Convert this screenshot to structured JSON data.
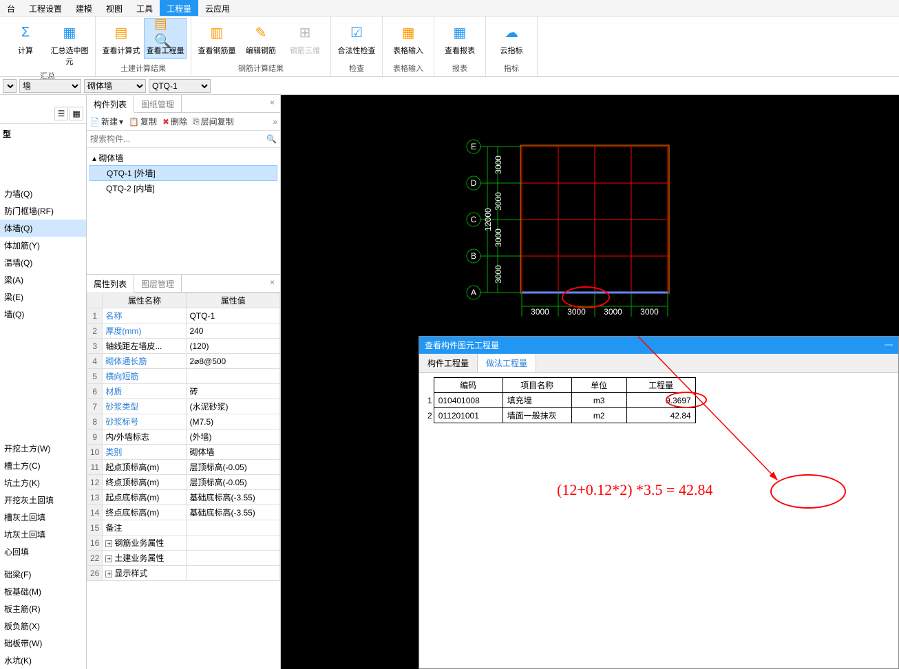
{
  "menu": [
    "台",
    "工程设置",
    "建模",
    "视图",
    "工具",
    "工程量",
    "云应用"
  ],
  "menu_active": 5,
  "ribbon": {
    "groups": [
      {
        "label": "汇总",
        "buttons": [
          {
            "icon": "Σ",
            "color": "#2196F3",
            "label": "计算"
          },
          {
            "icon": "▦",
            "color": "#2196F3",
            "label": "汇总选中图元"
          }
        ]
      },
      {
        "label": "土建计算结果",
        "buttons": [
          {
            "icon": "▤",
            "color": "#ff9800",
            "label": "查看计算式"
          },
          {
            "icon": "▤🔍",
            "color": "#ff9800",
            "label": "查看工程量",
            "active": true
          }
        ]
      },
      {
        "label": "钢筋计算结果",
        "buttons": [
          {
            "icon": "▥",
            "color": "#ff9800",
            "label": "查看钢筋量"
          },
          {
            "icon": "✎",
            "color": "#ff9800",
            "label": "编辑钢筋"
          },
          {
            "icon": "⊞",
            "color": "#bbb",
            "label": "钢筋三维",
            "disabled": true
          }
        ]
      },
      {
        "label": "检查",
        "buttons": [
          {
            "icon": "☑",
            "color": "#2196F3",
            "label": "合法性检查"
          }
        ]
      },
      {
        "label": "表格输入",
        "buttons": [
          {
            "icon": "▦",
            "color": "#ff9800",
            "label": "表格输入"
          }
        ]
      },
      {
        "label": "报表",
        "buttons": [
          {
            "icon": "▦",
            "color": "#2196F3",
            "label": "查看报表"
          }
        ]
      },
      {
        "label": "指标",
        "buttons": [
          {
            "icon": "☁",
            "color": "#2196F3",
            "label": "云指标"
          }
        ]
      }
    ]
  },
  "selectors": {
    "s1": "",
    "s2": "墙",
    "s3": "砌体墙",
    "s4": "QTQ-1"
  },
  "left_sidebar": {
    "title": "型",
    "items_top": [
      {
        "label": "力墙(Q)"
      },
      {
        "label": "防门框墙(RF)"
      },
      {
        "label": "体墙(Q)",
        "selected": true
      },
      {
        "label": "体加筋(Y)"
      },
      {
        "label": "温墙(Q)"
      },
      {
        "label": "梁(A)"
      },
      {
        "label": "梁(E)"
      },
      {
        "label": "墙(Q)"
      }
    ],
    "items_bottom": [
      "开挖土方(W)",
      "槽土方(C)",
      "坑土方(K)",
      "开挖灰土回填",
      "槽灰土回填",
      "坑灰土回填",
      "心回填",
      "",
      "础梁(F)",
      "板基础(M)",
      "板主筋(R)",
      "板负筋(X)",
      "础板带(W)",
      "水坑(K)"
    ]
  },
  "component_list": {
    "tabs": [
      "构件列表",
      "图纸管理"
    ],
    "toolbar": {
      "new": "新建",
      "copy": "复制",
      "delete": "删除",
      "floor_copy": "层间复制"
    },
    "search_placeholder": "搜索构件...",
    "tree": {
      "parent": "砌体墙",
      "children": [
        {
          "label": "QTQ-1 [外墙]",
          "selected": true
        },
        {
          "label": "QTQ-2 [内墙]"
        }
      ]
    }
  },
  "properties": {
    "tabs": [
      "属性列表",
      "图层管理"
    ],
    "headers": [
      "属性名称",
      "属性值"
    ],
    "rows": [
      {
        "n": "1",
        "name": "名称",
        "value": "QTQ-1",
        "link": true
      },
      {
        "n": "2",
        "name": "厚度(mm)",
        "value": "240",
        "link": true
      },
      {
        "n": "3",
        "name": "轴线距左墙皮...",
        "value": "(120)"
      },
      {
        "n": "4",
        "name": "砌体通长筋",
        "value": "2⌀8@500",
        "link": true
      },
      {
        "n": "5",
        "name": "横向短筋",
        "value": "",
        "link": true
      },
      {
        "n": "6",
        "name": "材质",
        "value": "砖",
        "link": true
      },
      {
        "n": "7",
        "name": "砂浆类型",
        "value": "(水泥砂浆)",
        "link": true
      },
      {
        "n": "8",
        "name": "砂浆标号",
        "value": "(M7.5)",
        "link": true
      },
      {
        "n": "9",
        "name": "内/外墙标志",
        "value": "(外墙)"
      },
      {
        "n": "10",
        "name": "类别",
        "value": "砌体墙",
        "link": true
      },
      {
        "n": "11",
        "name": "起点顶标高(m)",
        "value": "层顶标高(-0.05)"
      },
      {
        "n": "12",
        "name": "终点顶标高(m)",
        "value": "层顶标高(-0.05)"
      },
      {
        "n": "13",
        "name": "起点底标高(m)",
        "value": "基础底标高(-3.55)"
      },
      {
        "n": "14",
        "name": "终点底标高(m)",
        "value": "基础底标高(-3.55)"
      },
      {
        "n": "15",
        "name": "备注",
        "value": ""
      },
      {
        "n": "16",
        "name": "钢筋业务属性",
        "value": "",
        "exp": true
      },
      {
        "n": "22",
        "name": "土建业务属性",
        "value": "",
        "exp": true
      },
      {
        "n": "26",
        "name": "显示样式",
        "value": "",
        "exp": true
      }
    ]
  },
  "drawing": {
    "axis_labels_v": [
      "E",
      "D",
      "C",
      "B",
      "A"
    ],
    "axis_labels_h": [
      "3000",
      "3000",
      "3000",
      "3000"
    ],
    "total_v": "12000",
    "dim_v": [
      "3000",
      "3000",
      "3000",
      "3000"
    ]
  },
  "qty_dialog": {
    "title": "查看构件图元工程量",
    "tabs": [
      "构件工程量",
      "做法工程量"
    ],
    "active_tab": 1,
    "headers": [
      "编码",
      "项目名称",
      "单位",
      "工程量"
    ],
    "rows": [
      {
        "n": "1",
        "code": "010401008",
        "name": "填充墙",
        "unit": "m3",
        "qty": "9.3697"
      },
      {
        "n": "2",
        "code": "011201001",
        "name": "墙面一般抹灰",
        "unit": "m2",
        "qty": "42.84"
      }
    ]
  },
  "annotation": "(12+0.12*2)  *3.5 = 42.84"
}
